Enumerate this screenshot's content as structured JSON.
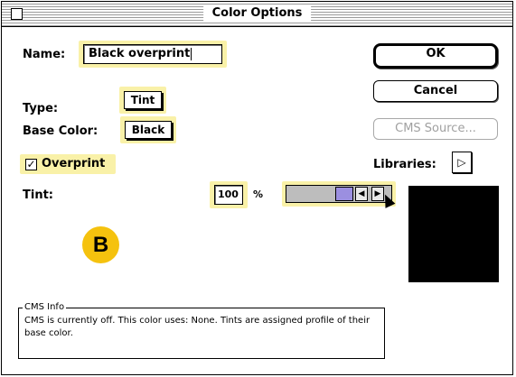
{
  "window": {
    "title": "Color Options"
  },
  "name": {
    "label": "Name:",
    "value": "Black overprint"
  },
  "type": {
    "label": "Type:",
    "value": "Tint"
  },
  "base_color": {
    "label": "Base Color:",
    "value": "Black"
  },
  "overprint": {
    "label": "Overprint",
    "checked": true,
    "check_glyph": "✓"
  },
  "tint": {
    "label": "Tint:",
    "value": "100",
    "unit": "%",
    "level_fraction": 1.0
  },
  "libraries": {
    "label": "Libraries:",
    "arrow": "▷"
  },
  "buttons": {
    "ok": "OK",
    "cancel": "Cancel",
    "cms_source": "CMS Source..."
  },
  "slider_arrows": {
    "left": "◀",
    "right": "▶"
  },
  "cms_info": {
    "legend": "CMS Info",
    "text": "CMS is currently off. This color uses: None. Tints are assigned profile of their base color."
  },
  "callout": {
    "letter": "B"
  },
  "colors": {
    "highlight": "#f9f1a8",
    "preview": "#000000",
    "thumb": "#9b8fe0",
    "callout": "#f5c20e"
  }
}
